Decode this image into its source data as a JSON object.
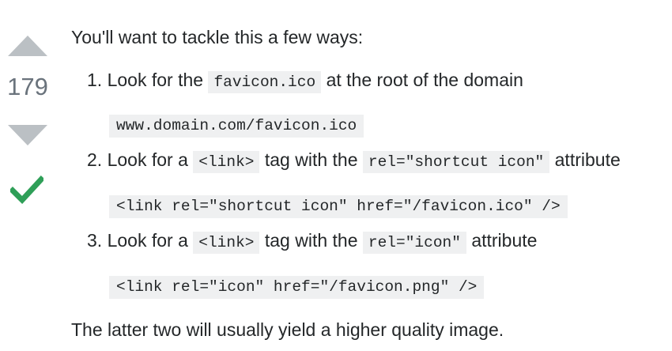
{
  "votes": {
    "score": "179",
    "up_icon": "arrow-up-icon",
    "down_icon": "arrow-down-icon",
    "accepted_icon": "checkmark-icon",
    "accepted_color": "#2f9f58",
    "arrow_color": "#bbc0c4"
  },
  "answer": {
    "intro": "You'll want to tackle this a few ways:",
    "steps": [
      {
        "number": "1.",
        "before": "Look for the",
        "code1": "favicon.ico",
        "after": "at the root of the domain",
        "example": "www.domain.com/favicon.ico"
      },
      {
        "number": "2.",
        "before": "Look for a",
        "code1": "<link>",
        "middle": "tag with the",
        "code2": "rel=\"shortcut icon\"",
        "after": "attribute",
        "example": "<link rel=\"shortcut icon\" href=\"/favicon.ico\" />"
      },
      {
        "number": "3.",
        "before": "Look for a",
        "code1": "<link>",
        "middle": "tag with the",
        "code2": "rel=\"icon\"",
        "after": "attribute",
        "example": "<link rel=\"icon\" href=\"/favicon.png\" />"
      }
    ],
    "outro": "The latter two will usually yield a higher quality image."
  }
}
